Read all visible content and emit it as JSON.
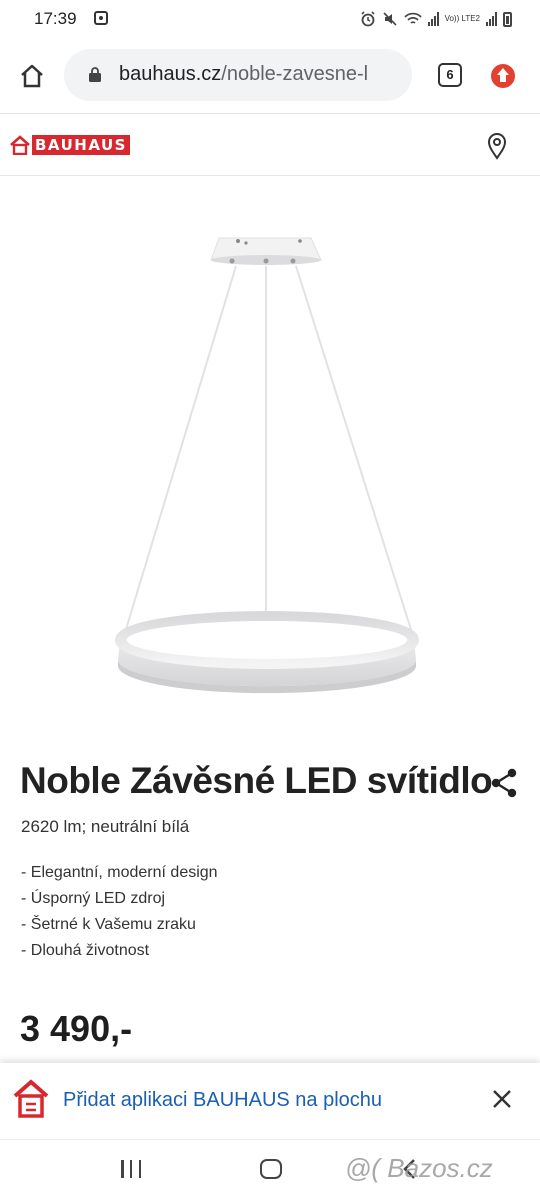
{
  "status_bar": {
    "time": "17:39",
    "network_label": "Vo)) LTE2"
  },
  "browser": {
    "url_domain": "bauhaus.cz",
    "url_path": "/noble-zavesne-l",
    "tab_count": "6"
  },
  "site": {
    "logo_text": "BAUHAUS",
    "brand_color": "#d8282f"
  },
  "product": {
    "title": "Noble Závěsné LED svítidlo",
    "subtitle": "2620 lm; neutrální bílá",
    "features": [
      "Elegantní, moderní design",
      "Úsporný LED zdroj",
      "Šetrné k Vašemu zraku",
      "Dlouhá životnost"
    ],
    "price": "3 490,-"
  },
  "install_banner": {
    "text": "Přidat aplikaci BAUHAUS na plochu"
  },
  "watermark": {
    "text": "@( Bazos.cz"
  }
}
